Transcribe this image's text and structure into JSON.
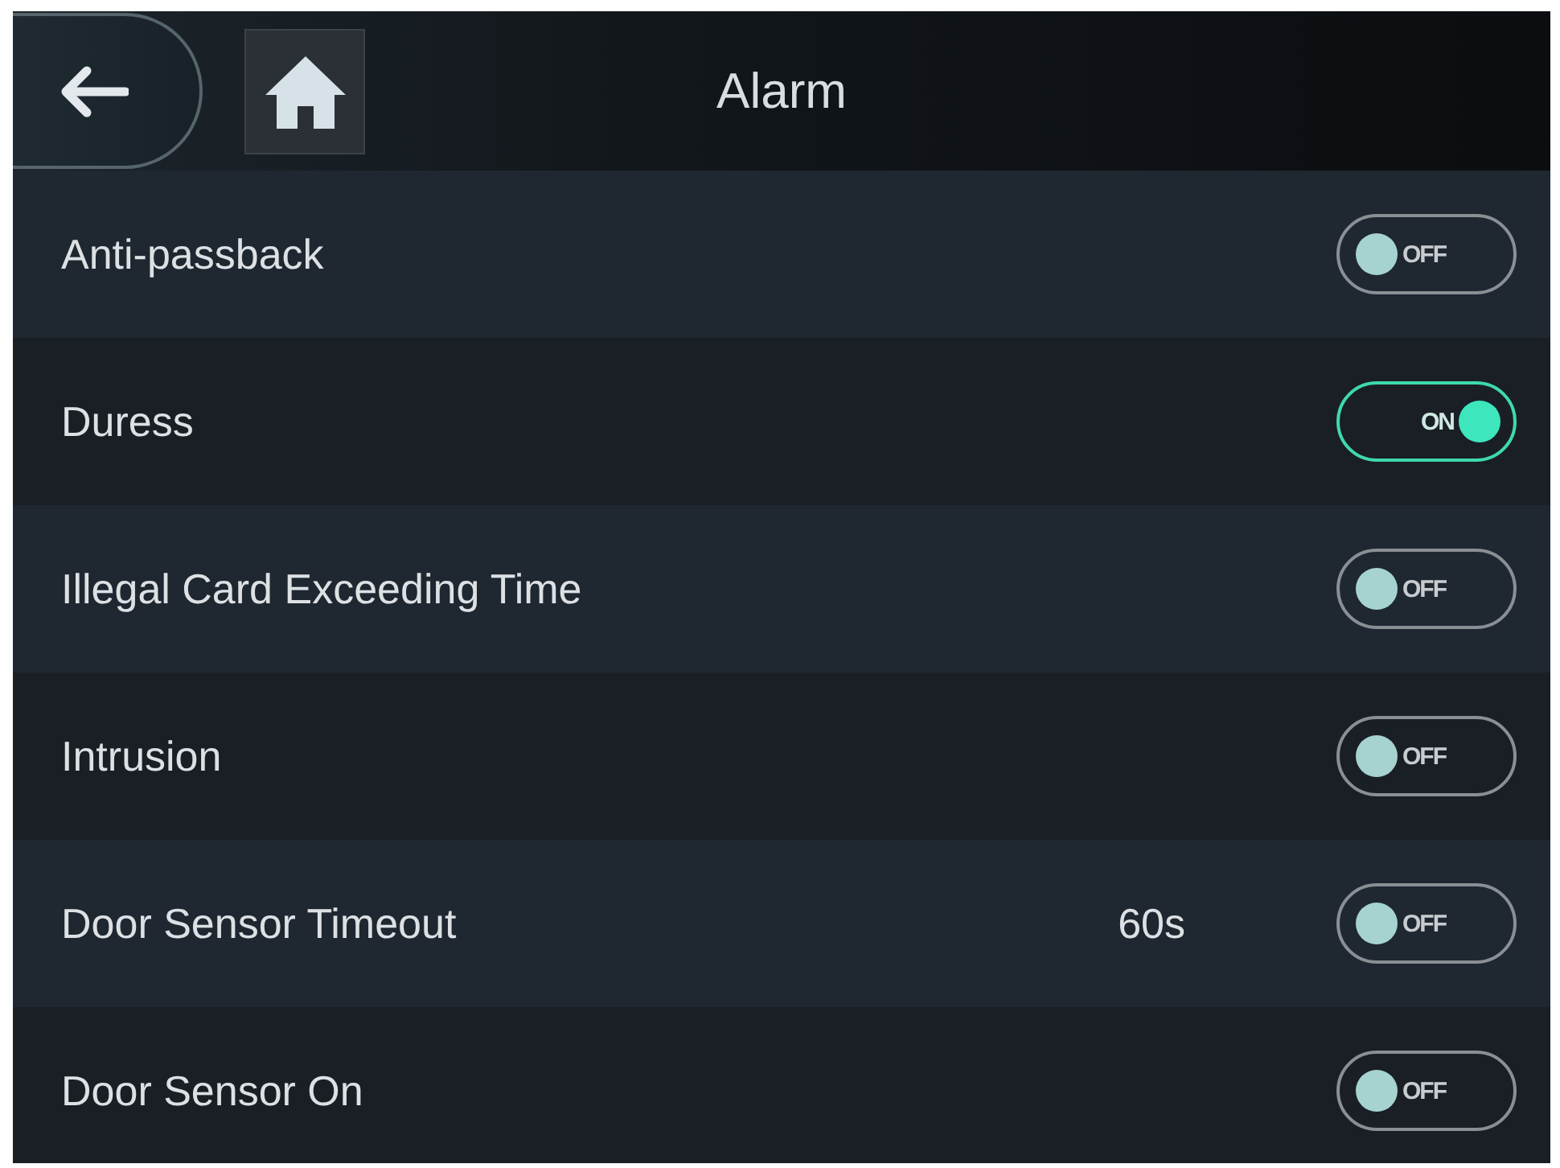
{
  "header": {
    "title": "Alarm"
  },
  "settings": [
    {
      "label": "Anti-passback",
      "on": false,
      "switch_text": "OFF"
    },
    {
      "label": "Duress",
      "on": true,
      "switch_text": "ON"
    },
    {
      "label": "Illegal Card Exceeding Time",
      "on": false,
      "switch_text": "OFF"
    },
    {
      "label": "Intrusion",
      "on": false,
      "switch_text": "OFF"
    },
    {
      "label": "Door Sensor Timeout",
      "value": "60s",
      "on": false,
      "switch_text": "OFF"
    },
    {
      "label": "Door Sensor On",
      "on": false,
      "switch_text": "OFF"
    }
  ]
}
